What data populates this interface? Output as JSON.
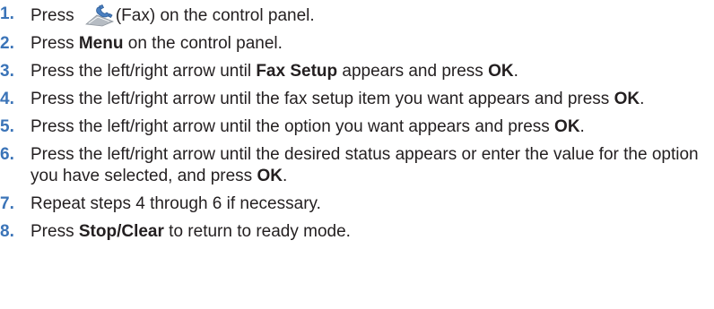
{
  "steps": [
    {
      "number": "1.",
      "parts": [
        {
          "text": "Press ",
          "bold": false
        },
        {
          "icon": "fax-icon"
        },
        {
          "text": "(Fax) on the control panel.",
          "bold": false
        }
      ]
    },
    {
      "number": "2.",
      "parts": [
        {
          "text": "Press ",
          "bold": false
        },
        {
          "text": "Menu",
          "bold": true
        },
        {
          "text": " on the control panel.",
          "bold": false
        }
      ]
    },
    {
      "number": "3.",
      "parts": [
        {
          "text": "Press the left/right arrow until ",
          "bold": false
        },
        {
          "text": "Fax Setup",
          "bold": true
        },
        {
          "text": " appears and press ",
          "bold": false
        },
        {
          "text": "OK",
          "bold": true
        },
        {
          "text": ".",
          "bold": false
        }
      ]
    },
    {
      "number": "4.",
      "parts": [
        {
          "text": "Press the left/right arrow until the fax setup item you want appears and press ",
          "bold": false
        },
        {
          "text": "OK",
          "bold": true
        },
        {
          "text": ".",
          "bold": false
        }
      ]
    },
    {
      "number": "5.",
      "parts": [
        {
          "text": "Press the left/right arrow until the option you want appears and press ",
          "bold": false
        },
        {
          "text": "OK",
          "bold": true
        },
        {
          "text": ".",
          "bold": false
        }
      ]
    },
    {
      "number": "6.",
      "parts": [
        {
          "text": "Press the left/right arrow until the desired status appears or enter the value for the option you have selected, and press ",
          "bold": false
        },
        {
          "text": "OK",
          "bold": true
        },
        {
          "text": ".",
          "bold": false
        }
      ]
    },
    {
      "number": "7.",
      "parts": [
        {
          "text": "Repeat steps 4 through 6 if necessary.",
          "bold": false
        }
      ]
    },
    {
      "number": "8.",
      "parts": [
        {
          "text": "Press ",
          "bold": false
        },
        {
          "text": "Stop/Clear",
          "bold": true
        },
        {
          "text": " to return to ready mode.",
          "bold": false
        }
      ]
    }
  ],
  "colors": {
    "step_number": "#3b74b8",
    "text": "#231f20",
    "icon_blue": "#4a7fc0",
    "icon_gray": "#9aa0a6"
  }
}
